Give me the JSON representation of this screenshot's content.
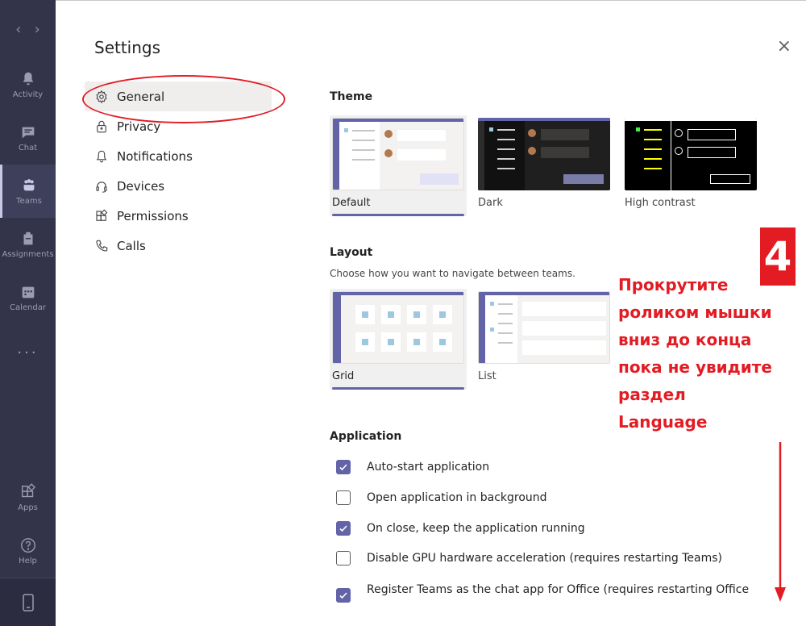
{
  "rail": {
    "items": [
      {
        "label": "Activity",
        "icon": "bell-icon"
      },
      {
        "label": "Chat",
        "icon": "chat-icon"
      },
      {
        "label": "Teams",
        "icon": "teams-icon"
      },
      {
        "label": "Assignments",
        "icon": "assignments-icon"
      },
      {
        "label": "Calendar",
        "icon": "calendar-icon"
      }
    ],
    "more": "...",
    "apps_label": "Apps",
    "help_label": "Help"
  },
  "dialog": {
    "title": "Settings",
    "close": "×"
  },
  "menu": {
    "items": [
      {
        "label": "General",
        "icon": "gear-icon"
      },
      {
        "label": "Privacy",
        "icon": "lock-icon"
      },
      {
        "label": "Notifications",
        "icon": "bell-icon"
      },
      {
        "label": "Devices",
        "icon": "headset-icon"
      },
      {
        "label": "Permissions",
        "icon": "apps-icon"
      },
      {
        "label": "Calls",
        "icon": "phone-icon"
      }
    ]
  },
  "theme": {
    "title": "Theme",
    "options": [
      {
        "label": "Default",
        "selected": true
      },
      {
        "label": "Dark",
        "selected": false
      },
      {
        "label": "High contrast",
        "selected": false
      }
    ]
  },
  "layout": {
    "title": "Layout",
    "desc": "Choose how you want to navigate between teams.",
    "options": [
      {
        "label": "Grid",
        "selected": true
      },
      {
        "label": "List",
        "selected": false
      }
    ]
  },
  "application": {
    "title": "Application",
    "options": [
      {
        "label": "Auto-start application",
        "checked": true
      },
      {
        "label": "Open application in background",
        "checked": false
      },
      {
        "label": "On close, keep the application running",
        "checked": true
      },
      {
        "label": "Disable GPU hardware acceleration (requires restarting Teams)",
        "checked": false
      },
      {
        "label": "Register Teams as the chat app for Office (requires restarting Office",
        "checked": true
      }
    ]
  },
  "annotation": {
    "step": "4",
    "lines": [
      "Прокрутите",
      "роликом мышки",
      "вниз до конца",
      "пока не увидите",
      "раздел",
      "Language"
    ],
    "color": "#e31b23"
  },
  "colors": {
    "accent": "#6264a7",
    "rail": "#33344a",
    "annotation": "#e31b23"
  }
}
